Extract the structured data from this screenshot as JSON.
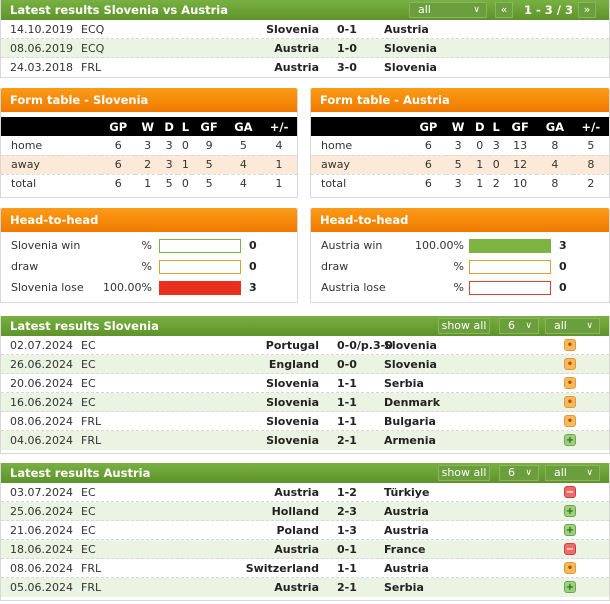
{
  "h2h_results": {
    "title": "Latest results Slovenia vs Austria",
    "filter": "all",
    "pager": {
      "prev": "«",
      "label": "1 - 3 / 3",
      "next": "»"
    },
    "rows": [
      {
        "date": "14.10.2019",
        "comp": "ECQ",
        "home": "Slovenia",
        "score": "0-1",
        "away": "Austria"
      },
      {
        "date": "08.06.2019",
        "comp": "ECQ",
        "home": "Austria",
        "score": "1-0",
        "away": "Slovenia"
      },
      {
        "date": "24.03.2018",
        "comp": "FRL",
        "home": "Austria",
        "score": "3-0",
        "away": "Slovenia"
      }
    ]
  },
  "form_tables": [
    {
      "title": "Form table - Slovenia",
      "headers": [
        "",
        "GP",
        "W",
        "D",
        "L",
        "GF",
        "GA",
        "+/-"
      ],
      "rows": [
        [
          "home",
          "6",
          "3",
          "3",
          "0",
          "9",
          "5",
          "4"
        ],
        [
          "away",
          "6",
          "2",
          "3",
          "1",
          "5",
          "4",
          "1"
        ],
        [
          "total",
          "6",
          "1",
          "5",
          "0",
          "5",
          "4",
          "1"
        ]
      ]
    },
    {
      "title": "Form table - Austria",
      "headers": [
        "",
        "GP",
        "W",
        "D",
        "L",
        "GF",
        "GA",
        "+/-"
      ],
      "rows": [
        [
          "home",
          "6",
          "3",
          "0",
          "3",
          "13",
          "8",
          "5"
        ],
        [
          "away",
          "6",
          "5",
          "1",
          "0",
          "12",
          "4",
          "8"
        ],
        [
          "total",
          "6",
          "3",
          "1",
          "2",
          "10",
          "8",
          "2"
        ]
      ]
    }
  ],
  "head_to_head": [
    {
      "title": "Head-to-head",
      "rows": [
        {
          "label": "Slovenia win",
          "pct": "%",
          "fill": 0,
          "count": "0",
          "color": "#7cb342"
        },
        {
          "label": "draw",
          "pct": "%",
          "fill": 0,
          "count": "0",
          "color": "#e0a030"
        },
        {
          "label": "Slovenia lose",
          "pct": "100.00%",
          "fill": 100,
          "count": "3",
          "color": "#e8301c"
        }
      ]
    },
    {
      "title": "Head-to-head",
      "rows": [
        {
          "label": "Austria win",
          "pct": "100.00%",
          "fill": 100,
          "count": "3",
          "color": "#7cb342"
        },
        {
          "label": "draw",
          "pct": "%",
          "fill": 0,
          "count": "0",
          "color": "#e0a030"
        },
        {
          "label": "Austria lose",
          "pct": "%",
          "fill": 0,
          "count": "0",
          "color": "#d84030"
        }
      ]
    }
  ],
  "latest_slovenia": {
    "title": "Latest results Slovenia",
    "show_all": "show all",
    "count": "6",
    "filter": "all",
    "rows": [
      {
        "date": "02.07.2024",
        "comp": "EC",
        "home": "Portugal",
        "score": "0-0/p.3-0",
        "away": "Slovenia",
        "result": "draw"
      },
      {
        "date": "26.06.2024",
        "comp": "EC",
        "home": "England",
        "score": "0-0",
        "away": "Slovenia",
        "result": "draw"
      },
      {
        "date": "20.06.2024",
        "comp": "EC",
        "home": "Slovenia",
        "score": "1-1",
        "away": "Serbia",
        "result": "draw"
      },
      {
        "date": "16.06.2024",
        "comp": "EC",
        "home": "Slovenia",
        "score": "1-1",
        "away": "Denmark",
        "result": "draw"
      },
      {
        "date": "08.06.2024",
        "comp": "FRL",
        "home": "Slovenia",
        "score": "1-1",
        "away": "Bulgaria",
        "result": "draw"
      },
      {
        "date": "04.06.2024",
        "comp": "FRL",
        "home": "Slovenia",
        "score": "2-1",
        "away": "Armenia",
        "result": "win"
      }
    ]
  },
  "latest_austria": {
    "title": "Latest results Austria",
    "show_all": "show all",
    "count": "6",
    "filter": "all",
    "rows": [
      {
        "date": "03.07.2024",
        "comp": "EC",
        "home": "Austria",
        "score": "1-2",
        "away": "Türkiye",
        "result": "lose"
      },
      {
        "date": "25.06.2024",
        "comp": "EC",
        "home": "Holland",
        "score": "2-3",
        "away": "Austria",
        "result": "win"
      },
      {
        "date": "21.06.2024",
        "comp": "EC",
        "home": "Poland",
        "score": "1-3",
        "away": "Austria",
        "result": "win"
      },
      {
        "date": "18.06.2024",
        "comp": "EC",
        "home": "Austria",
        "score": "0-1",
        "away": "France",
        "result": "lose"
      },
      {
        "date": "08.06.2024",
        "comp": "FRL",
        "home": "Switzerland",
        "score": "1-1",
        "away": "Austria",
        "result": "draw"
      },
      {
        "date": "05.06.2024",
        "comp": "FRL",
        "home": "Austria",
        "score": "2-1",
        "away": "Serbia",
        "result": "win"
      }
    ]
  },
  "icons": {
    "win": "+",
    "draw": "•",
    "lose": "−",
    "chevron": "⌄"
  }
}
